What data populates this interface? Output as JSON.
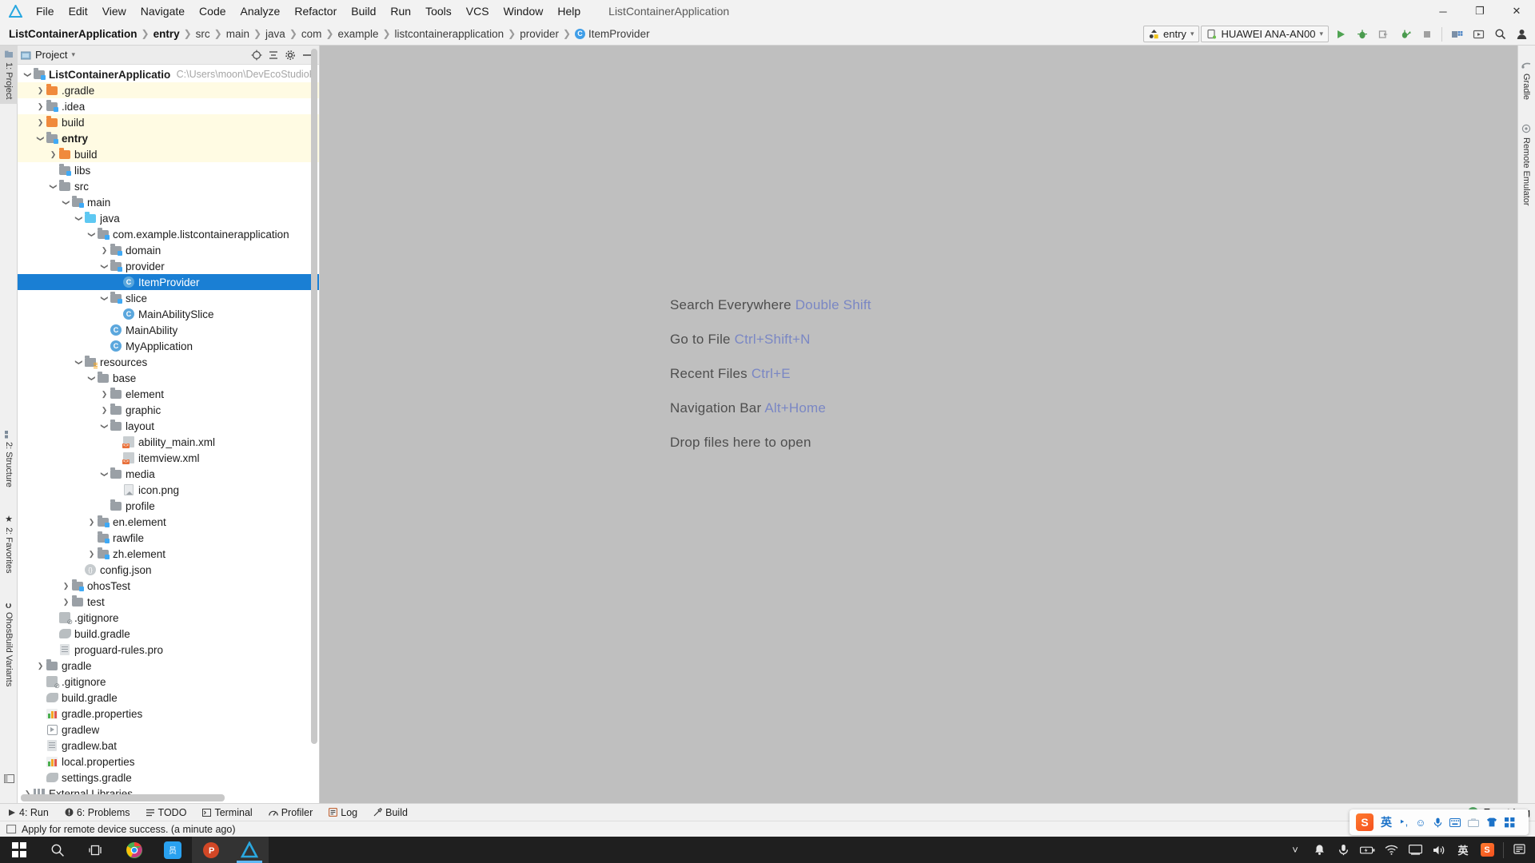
{
  "window": {
    "app_title": "ListContainerApplication",
    "controls": {
      "minimize": "─",
      "maximize": "❐",
      "close": "✕"
    }
  },
  "menubar": {
    "items": [
      {
        "label": "File",
        "mnemonic": "F"
      },
      {
        "label": "Edit",
        "mnemonic": "E"
      },
      {
        "label": "View",
        "mnemonic": "V"
      },
      {
        "label": "Navigate",
        "mnemonic": "N"
      },
      {
        "label": "Code",
        "mnemonic": "C"
      },
      {
        "label": "Analyze",
        "mnemonic": ""
      },
      {
        "label": "Refactor",
        "mnemonic": "R"
      },
      {
        "label": "Build",
        "mnemonic": "B"
      },
      {
        "label": "Run",
        "mnemonic": "u"
      },
      {
        "label": "Tools",
        "mnemonic": "T"
      },
      {
        "label": "VCS",
        "mnemonic": "S"
      },
      {
        "label": "Window",
        "mnemonic": "W"
      },
      {
        "label": "Help",
        "mnemonic": "H"
      }
    ]
  },
  "breadcrumb": {
    "items": [
      "ListContainerApplication",
      "entry",
      "src",
      "main",
      "java",
      "com",
      "example",
      "listcontainerapplication",
      "provider"
    ],
    "leaf": "ItemProvider",
    "leaf_icon_letter": "C"
  },
  "toolbar": {
    "run_config": "entry",
    "device": "HUAWEI ANA-AN00",
    "buttons": [
      {
        "name": "run-button",
        "icon": "play-icon",
        "color": "#4fa352"
      },
      {
        "name": "debug-button",
        "icon": "bug-icon",
        "color": "#4a9b4e"
      },
      {
        "name": "run-with-coverage-button",
        "icon": "coverage-icon",
        "color": "#9a9a9a"
      },
      {
        "name": "profile-button",
        "icon": "profiler-icon",
        "color": "#4a9b4e"
      },
      {
        "name": "stop-button",
        "icon": "stop-icon",
        "color": "#9a9a9a"
      },
      {
        "name": "project-structure-button",
        "icon": "structure-icon",
        "color": "#5b7ea8"
      },
      {
        "name": "device-manager-button",
        "icon": "device-icon",
        "color": "#5a5a5a"
      },
      {
        "name": "search-everywhere-button",
        "icon": "search-icon",
        "color": "#3c3c3c"
      },
      {
        "name": "avatar-button",
        "icon": "account-icon",
        "color": "#3c3c3c"
      }
    ]
  },
  "left_strip": {
    "tabs": [
      {
        "label": "1: Project",
        "mnemonic": "1",
        "icon": "project-icon",
        "active": true
      },
      {
        "label": "2: Structure",
        "mnemonic": "2",
        "icon": "structure-icon",
        "active": false
      },
      {
        "label": "2: Favorites",
        "mnemonic": "2",
        "icon": "star-icon",
        "active": false
      },
      {
        "label": "OhosBuild Variants",
        "mnemonic": "",
        "icon": "variants-icon",
        "active": false
      }
    ]
  },
  "right_strip": {
    "tabs": [
      {
        "label": "Gradle",
        "icon": "gradle-icon"
      },
      {
        "label": "Remote Emulator",
        "icon": "emulator-icon"
      }
    ]
  },
  "project_panel": {
    "title": "Project",
    "tools": [
      {
        "name": "scroll-from-source-icon",
        "glyph": "⊕"
      },
      {
        "name": "collapse-all-icon",
        "glyph": "≡"
      },
      {
        "name": "settings-gear-icon",
        "glyph": "⚙"
      },
      {
        "name": "hide-panel-icon",
        "glyph": "─"
      }
    ],
    "tree": [
      {
        "label": "ListContainerApplication",
        "path": "C:\\Users\\moon\\DevEcoStudioP",
        "indent": 0,
        "arrow": "down",
        "icon": "module-root",
        "bold": true,
        "hl": false,
        "sel": false
      },
      {
        "label": ".gradle",
        "indent": 1,
        "arrow": "right",
        "icon": "folder-orange",
        "hl": true
      },
      {
        "label": ".idea",
        "indent": 1,
        "arrow": "right",
        "icon": "folder-gray-mod",
        "hl": false
      },
      {
        "label": "build",
        "indent": 1,
        "arrow": "right",
        "icon": "folder-orange",
        "hl": true
      },
      {
        "label": "entry",
        "indent": 1,
        "arrow": "down",
        "icon": "module",
        "bold": true,
        "hl": true
      },
      {
        "label": "build",
        "indent": 2,
        "arrow": "right",
        "icon": "folder-orange",
        "hl": true
      },
      {
        "label": "libs",
        "indent": 2,
        "arrow": "none",
        "icon": "folder-gray-mod",
        "hl": false
      },
      {
        "label": "src",
        "indent": 2,
        "arrow": "down",
        "icon": "folder-gray",
        "hl": false
      },
      {
        "label": "main",
        "indent": 3,
        "arrow": "down",
        "icon": "folder-gray-mod",
        "hl": false
      },
      {
        "label": "java",
        "indent": 4,
        "arrow": "down",
        "icon": "folder-blue",
        "hl": false
      },
      {
        "label": "com.example.listcontainerapplication",
        "indent": 5,
        "arrow": "down",
        "icon": "folder-gray-mod",
        "hl": false
      },
      {
        "label": "domain",
        "indent": 6,
        "arrow": "right",
        "icon": "folder-gray-mod",
        "hl": false
      },
      {
        "label": "provider",
        "indent": 6,
        "arrow": "down",
        "icon": "folder-gray-mod",
        "hl": false
      },
      {
        "label": "ItemProvider",
        "indent": 7,
        "arrow": "none",
        "icon": "class",
        "sel": true
      },
      {
        "label": "slice",
        "indent": 6,
        "arrow": "down",
        "icon": "folder-gray-mod",
        "hl": false
      },
      {
        "label": "MainAbilitySlice",
        "indent": 7,
        "arrow": "none",
        "icon": "class",
        "hl": false
      },
      {
        "label": "MainAbility",
        "indent": 6,
        "arrow": "none",
        "icon": "class",
        "hl": false
      },
      {
        "label": "MyApplication",
        "indent": 6,
        "arrow": "none",
        "icon": "class",
        "hl": false
      },
      {
        "label": "resources",
        "indent": 4,
        "arrow": "down",
        "icon": "resources",
        "hl": false
      },
      {
        "label": "base",
        "indent": 5,
        "arrow": "down",
        "icon": "folder-gray",
        "hl": false
      },
      {
        "label": "element",
        "indent": 6,
        "arrow": "right",
        "icon": "folder-gray",
        "hl": false
      },
      {
        "label": "graphic",
        "indent": 6,
        "arrow": "right",
        "icon": "folder-gray",
        "hl": false
      },
      {
        "label": "layout",
        "indent": 6,
        "arrow": "down",
        "icon": "folder-gray",
        "hl": false
      },
      {
        "label": "ability_main.xml",
        "indent": 7,
        "arrow": "none",
        "icon": "xml",
        "hl": false
      },
      {
        "label": "itemview.xml",
        "indent": 7,
        "arrow": "none",
        "icon": "xml",
        "hl": false
      },
      {
        "label": "media",
        "indent": 6,
        "arrow": "down",
        "icon": "folder-gray",
        "hl": false
      },
      {
        "label": "icon.png",
        "indent": 7,
        "arrow": "none",
        "icon": "png",
        "hl": false
      },
      {
        "label": "profile",
        "indent": 6,
        "arrow": "none",
        "icon": "folder-gray",
        "hl": false
      },
      {
        "label": "en.element",
        "indent": 5,
        "arrow": "right",
        "icon": "folder-gray-mod",
        "hl": false
      },
      {
        "label": "rawfile",
        "indent": 5,
        "arrow": "none",
        "icon": "folder-gray-mod",
        "hl": false
      },
      {
        "label": "zh.element",
        "indent": 5,
        "arrow": "right",
        "icon": "folder-gray-mod",
        "hl": false
      },
      {
        "label": "config.json",
        "indent": 4,
        "arrow": "none",
        "icon": "json",
        "hl": false
      },
      {
        "label": "ohosTest",
        "indent": 3,
        "arrow": "right",
        "icon": "folder-gray-mod",
        "hl": false
      },
      {
        "label": "test",
        "indent": 3,
        "arrow": "right",
        "icon": "folder-gray",
        "hl": false
      },
      {
        "label": ".gitignore",
        "indent": 2,
        "arrow": "none",
        "icon": "git",
        "hl": false
      },
      {
        "label": "build.gradle",
        "indent": 2,
        "arrow": "none",
        "icon": "gradle",
        "hl": false
      },
      {
        "label": "proguard-rules.pro",
        "indent": 2,
        "arrow": "none",
        "icon": "file",
        "hl": false
      },
      {
        "label": "gradle",
        "indent": 1,
        "arrow": "right",
        "icon": "folder-gray",
        "hl": false
      },
      {
        "label": ".gitignore",
        "indent": 1,
        "arrow": "none",
        "icon": "git",
        "hl": false
      },
      {
        "label": "build.gradle",
        "indent": 1,
        "arrow": "none",
        "icon": "gradle",
        "hl": false
      },
      {
        "label": "gradle.properties",
        "indent": 1,
        "arrow": "none",
        "icon": "properties",
        "hl": false
      },
      {
        "label": "gradlew",
        "indent": 1,
        "arrow": "none",
        "icon": "script",
        "hl": false
      },
      {
        "label": "gradlew.bat",
        "indent": 1,
        "arrow": "none",
        "icon": "file",
        "hl": false
      },
      {
        "label": "local.properties",
        "indent": 1,
        "arrow": "none",
        "icon": "properties",
        "hl": false
      },
      {
        "label": "settings.gradle",
        "indent": 1,
        "arrow": "none",
        "icon": "gradle",
        "hl": false
      },
      {
        "label": "External Libraries",
        "indent": 0,
        "arrow": "right",
        "icon": "libraries",
        "hl": false
      }
    ]
  },
  "editor": {
    "hints": [
      {
        "text": "Search Everywhere",
        "key": "Double Shift"
      },
      {
        "text": "Go to File",
        "key": "Ctrl+Shift+N"
      },
      {
        "text": "Recent Files",
        "key": "Ctrl+E"
      },
      {
        "text": "Navigation Bar",
        "key": "Alt+Home"
      },
      {
        "text": "Drop files here to open",
        "key": ""
      }
    ]
  },
  "bottom_bar": {
    "items": [
      {
        "label": "4: Run",
        "mnemonic": "4",
        "icon": "play-icon"
      },
      {
        "label": "6: Problems",
        "mnemonic": "6",
        "icon": "problems-icon"
      },
      {
        "label": "TODO",
        "mnemonic": "",
        "icon": "todo-icon"
      },
      {
        "label": "Terminal",
        "mnemonic": "",
        "icon": "terminal-icon"
      },
      {
        "label": "Profiler",
        "mnemonic": "",
        "icon": "profiler-icon"
      },
      {
        "label": "Log",
        "mnemonic": "",
        "icon": "log-icon"
      },
      {
        "label": "Build",
        "mnemonic": "",
        "icon": "build-icon"
      }
    ],
    "event_log": "Event Log",
    "event_count": "3"
  },
  "status_bar": {
    "message": "Apply for remote device success. (a minute ago)",
    "icon": "notification-icon"
  },
  "ime_bar": {
    "logo": "S",
    "mode": "英",
    "icons": [
      "punctuation-icon",
      "emoji-icon",
      "voice-icon",
      "keyboard-icon",
      "toolbox-icon",
      "skin-icon",
      "apps-icon"
    ]
  },
  "taskbar": {
    "items": [
      {
        "name": "start-button",
        "icon": "windows-logo"
      },
      {
        "name": "search-taskbar-button",
        "icon": "search-icon"
      },
      {
        "name": "task-view-button",
        "icon": "task-view-icon"
      },
      {
        "name": "chrome-taskbar-button",
        "icon": "chrome-icon"
      },
      {
        "name": "wps-taskbar-button",
        "icon": "wps-icon"
      },
      {
        "name": "powerpoint-taskbar-button",
        "icon": "powerpoint-icon"
      },
      {
        "name": "devecostudio-taskbar-button",
        "icon": "deveco-icon"
      }
    ],
    "tray": [
      "chevron-up-icon",
      "bell-icon",
      "microphone-icon",
      "battery-icon",
      "wifi-icon",
      "display-icon",
      "volume-icon"
    ],
    "tray_lang": "英",
    "tray_sogou": "S",
    "tray_notes": "notes-icon"
  },
  "colors": {
    "selection_blue": "#1a7fd4",
    "editor_bg": "#bfbfbf",
    "panel_bg": "#f2f2f2",
    "highlight_yellow": "#fffbe3",
    "hint_key": "#7a87c4",
    "accent_green": "#59a869"
  }
}
